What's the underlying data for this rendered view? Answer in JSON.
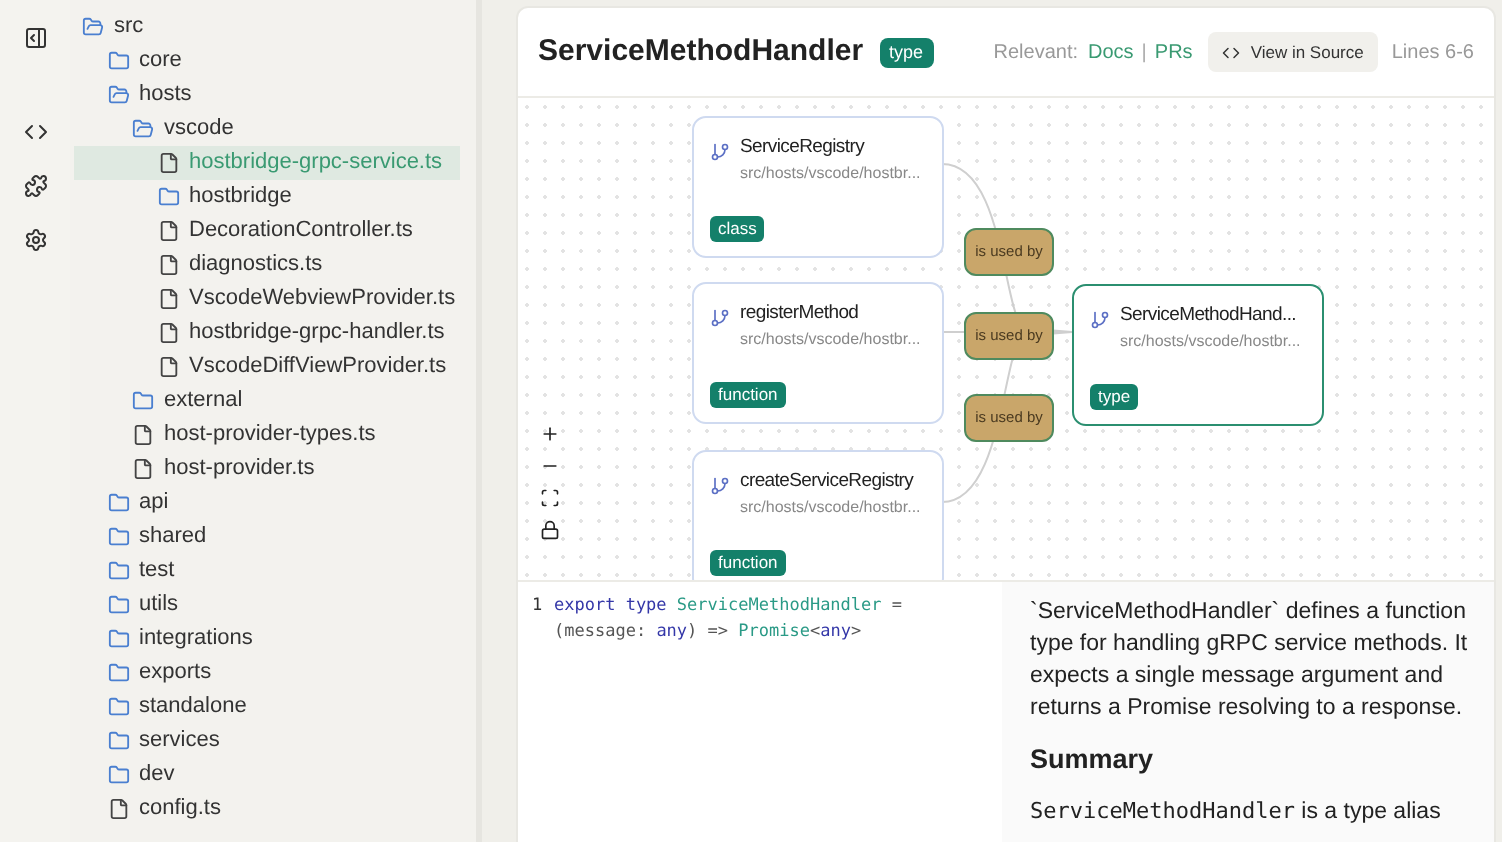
{
  "rail": [
    {
      "kind": "panel"
    },
    {
      "kind": "code"
    },
    {
      "kind": "puzzle"
    },
    {
      "kind": "settings"
    }
  ],
  "tree": [
    {
      "name": "src",
      "kind": "folder",
      "expanded": true,
      "selected": false,
      "children": [
        {
          "name": "core",
          "kind": "folder",
          "expanded": false,
          "selected": false
        },
        {
          "name": "hosts",
          "kind": "folder",
          "expanded": true,
          "selected": false,
          "children": [
            {
              "name": "vscode",
              "kind": "folder",
              "expanded": true,
              "selected": false,
              "children": [
                {
                  "name": "hostbridge-grpc-service.ts",
                  "kind": "file",
                  "selected": true
                },
                {
                  "name": "hostbridge",
                  "kind": "folder",
                  "expanded": false,
                  "selected": false
                },
                {
                  "name": "DecorationController.ts",
                  "kind": "file",
                  "selected": false
                },
                {
                  "name": "diagnostics.ts",
                  "kind": "file",
                  "selected": false
                },
                {
                  "name": "VscodeWebviewProvider.ts",
                  "kind": "file",
                  "selected": false
                },
                {
                  "name": "hostbridge-grpc-handler.ts",
                  "kind": "file",
                  "selected": false
                },
                {
                  "name": "VscodeDiffViewProvider.ts",
                  "kind": "file",
                  "selected": false
                }
              ]
            },
            {
              "name": "external",
              "kind": "folder",
              "expanded": false,
              "selected": false
            },
            {
              "name": "host-provider-types.ts",
              "kind": "file",
              "selected": false
            },
            {
              "name": "host-provider.ts",
              "kind": "file",
              "selected": false
            }
          ]
        },
        {
          "name": "api",
          "kind": "folder",
          "expanded": false,
          "selected": false
        },
        {
          "name": "shared",
          "kind": "folder",
          "expanded": false,
          "selected": false
        },
        {
          "name": "test",
          "kind": "folder",
          "expanded": false,
          "selected": false
        },
        {
          "name": "utils",
          "kind": "folder",
          "expanded": false,
          "selected": false
        },
        {
          "name": "integrations",
          "kind": "folder",
          "expanded": false,
          "selected": false
        },
        {
          "name": "exports",
          "kind": "folder",
          "expanded": false,
          "selected": false
        },
        {
          "name": "standalone",
          "kind": "folder",
          "expanded": false,
          "selected": false
        },
        {
          "name": "services",
          "kind": "folder",
          "expanded": false,
          "selected": false
        },
        {
          "name": "dev",
          "kind": "folder",
          "expanded": false,
          "selected": false
        },
        {
          "name": "config.ts",
          "kind": "file",
          "selected": false
        }
      ]
    }
  ],
  "header": {
    "title": "ServiceMethodHandler",
    "badge": "type",
    "relevant_label": "Relevant:",
    "links": [
      "Docs",
      "PRs"
    ],
    "separator": "|",
    "source_button": "View in Source",
    "lines": "Lines 6-6"
  },
  "graph": {
    "nodes": [
      {
        "name": "ServiceRegistry",
        "path": "src/hosts/vscode/hostbr...",
        "tag": "class",
        "selected": false
      },
      {
        "name": "registerMethod",
        "path": "src/hosts/vscode/hostbr...",
        "tag": "function",
        "selected": false
      },
      {
        "name": "createServiceRegistry",
        "path": "src/hosts/vscode/hostbr...",
        "tag": "function",
        "selected": false
      },
      {
        "name": "ServiceMethodHand...",
        "path": "src/hosts/vscode/hostbr...",
        "tag": "type",
        "selected": true
      }
    ],
    "edges": [
      {
        "label": "is used by"
      },
      {
        "label": "is used by"
      },
      {
        "label": "is used by"
      }
    ],
    "controls": [
      {
        "kind": "zoom-in"
      },
      {
        "kind": "zoom-out"
      },
      {
        "kind": "fit"
      },
      {
        "kind": "lock"
      }
    ]
  },
  "code": {
    "lines": [
      {
        "number": "1",
        "tokens": [
          {
            "kind": "keyword",
            "text": "export type "
          },
          {
            "kind": "type",
            "text": "ServiceMethodHandler"
          },
          {
            "kind": "plain",
            "text": " ="
          }
        ]
      },
      {
        "tokens": [
          {
            "kind": "plain",
            "text": "(message: "
          },
          {
            "kind": "keyword",
            "text": "any"
          },
          {
            "kind": "plain",
            "text": ") => "
          },
          {
            "kind": "type",
            "text": "Promise"
          },
          {
            "kind": "plain",
            "text": "<"
          },
          {
            "kind": "keyword",
            "text": "any"
          },
          {
            "kind": "plain",
            "text": ">"
          }
        ]
      }
    ]
  },
  "description": {
    "intro": "`ServiceMethodHandler` defines a function type for handling gRPC service methods. It expects a single message argument and returns a Promise resolving to a response.",
    "heading": "Summary",
    "summary_code": "ServiceMethodHandler",
    "summary_text": "is a type alias"
  }
}
